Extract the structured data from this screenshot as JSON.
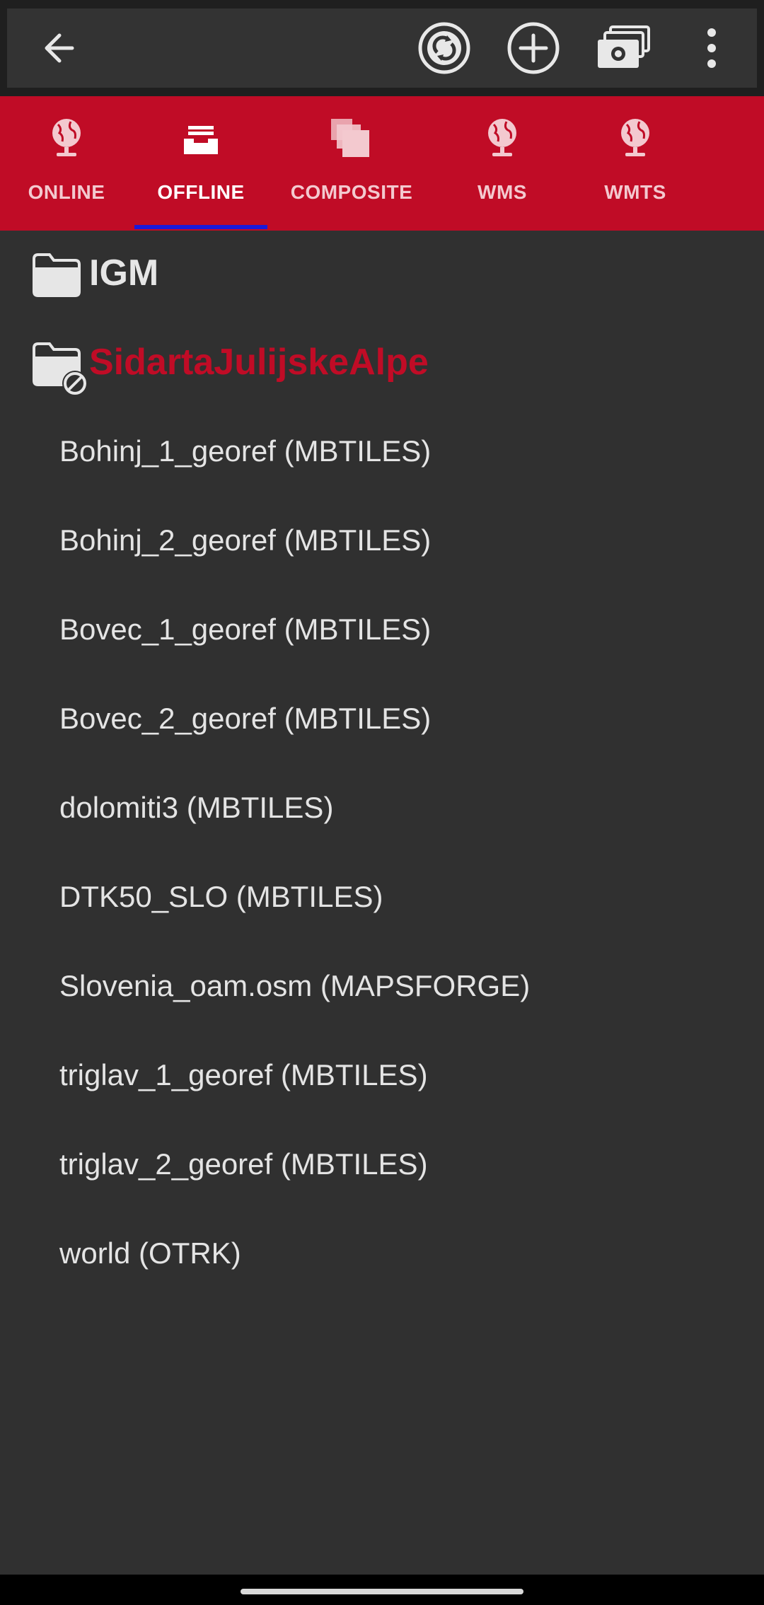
{
  "appbar": {
    "back": "back-arrow-icon",
    "actions": [
      "sync-icon",
      "add-icon",
      "cash-stack-icon",
      "more-vert-icon"
    ]
  },
  "tabs": [
    {
      "label": "ONLINE",
      "icon": "globe-icon"
    },
    {
      "label": "OFFLINE",
      "icon": "inbox-icon",
      "active": true
    },
    {
      "label": "COMPOSITE",
      "icon": "layers-icon"
    },
    {
      "label": "WMS",
      "icon": "globe-icon"
    },
    {
      "label": "WMTS",
      "icon": "globe-icon"
    }
  ],
  "folders": [
    {
      "label": "IGM",
      "icon": "folder-icon",
      "expanded": false
    },
    {
      "label": "SidartaJulijskeAlpe",
      "icon": "folder-disabled-icon",
      "expanded": true,
      "color": "#c00c26"
    }
  ],
  "files": [
    "Bohinj_1_georef (MBTILES)",
    "Bohinj_2_georef (MBTILES)",
    "Bovec_1_georef (MBTILES)",
    "Bovec_2_georef (MBTILES)",
    "dolomiti3 (MBTILES)",
    "DTK50_SLO (MBTILES)",
    "Slovenia_oam.osm (MAPSFORGE)",
    "triglav_1_georef (MBTILES)",
    "triglav_2_georef (MBTILES)",
    "world (OTRK)"
  ],
  "colors": {
    "accent": "#c00c26",
    "indicator": "#1a1adb",
    "background": "#303030"
  }
}
